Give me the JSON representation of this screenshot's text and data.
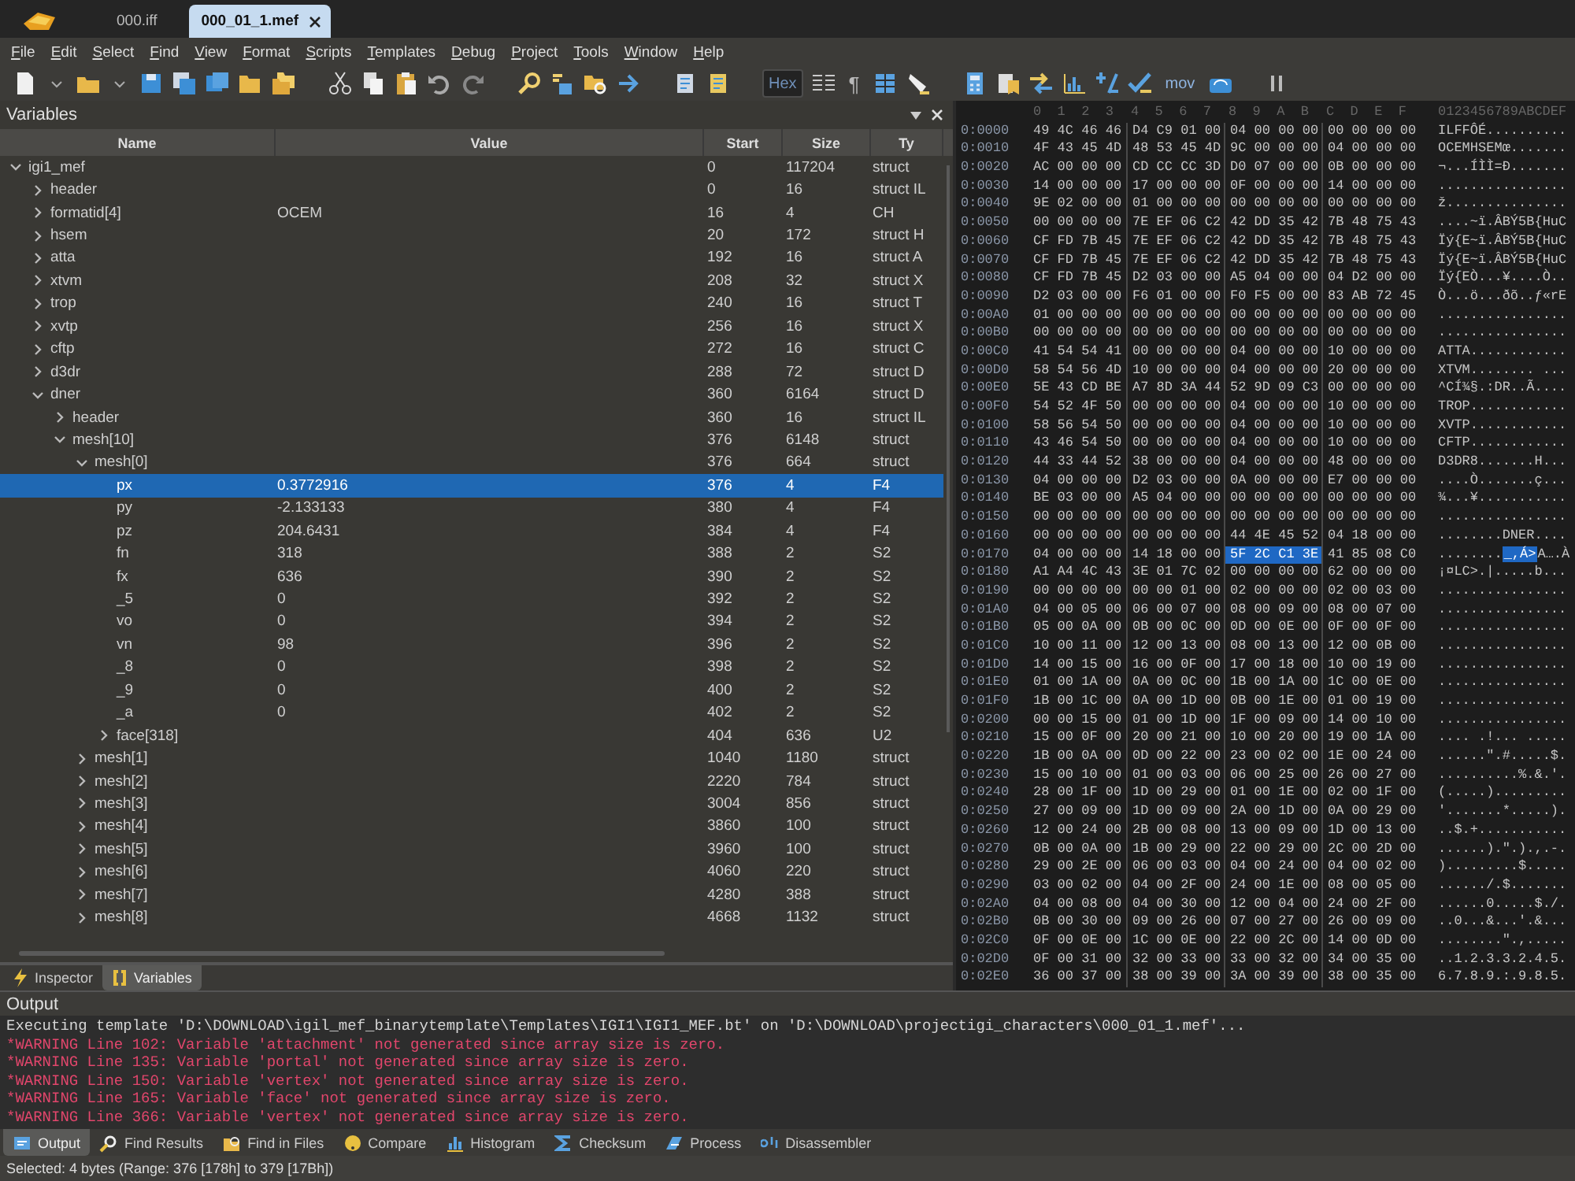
{
  "tabs": [
    {
      "label": "000.iff",
      "selected": false
    },
    {
      "label": "000_01_1.mef",
      "selected": true
    }
  ],
  "menu": [
    "File",
    "Edit",
    "Select",
    "Find",
    "View",
    "Format",
    "Scripts",
    "Templates",
    "Debug",
    "Project",
    "Tools",
    "Window",
    "Help"
  ],
  "toolbar": {
    "text_buttons": [
      {
        "label": "Hex",
        "pressed": true
      },
      {
        "label": "¶",
        "pressed": false
      },
      {
        "label": "mov",
        "pressed": false
      }
    ]
  },
  "variables": {
    "title": "Variables",
    "columns": [
      "Name",
      "Value",
      "Start",
      "Size",
      "Ty"
    ],
    "tree": [
      {
        "name": "igi1_mef",
        "start": "0",
        "size": "117204",
        "type": "struct",
        "selected": false,
        "expanded": true,
        "children": [
          {
            "name": "header",
            "start": "0",
            "size": "16",
            "type": "struct IL",
            "selected": false,
            "expanded": false
          },
          {
            "name": "formatid[4]",
            "value": "OCEM",
            "start": "16",
            "size": "4",
            "type": "CH",
            "selected": false,
            "expanded": false
          },
          {
            "name": "hsem",
            "start": "20",
            "size": "172",
            "type": "struct H",
            "selected": false,
            "expanded": false
          },
          {
            "name": "atta",
            "start": "192",
            "size": "16",
            "type": "struct A",
            "selected": false,
            "expanded": false
          },
          {
            "name": "xtvm",
            "start": "208",
            "size": "32",
            "type": "struct X",
            "selected": false,
            "expanded": false
          },
          {
            "name": "trop",
            "start": "240",
            "size": "16",
            "type": "struct T",
            "selected": false,
            "expanded": false
          },
          {
            "name": "xvtp",
            "start": "256",
            "size": "16",
            "type": "struct X",
            "selected": false,
            "expanded": false
          },
          {
            "name": "cftp",
            "start": "272",
            "size": "16",
            "type": "struct C",
            "selected": false,
            "expanded": false
          },
          {
            "name": "d3dr",
            "start": "288",
            "size": "72",
            "type": "struct D",
            "selected": false,
            "expanded": false
          },
          {
            "name": "dner",
            "start": "360",
            "size": "6164",
            "type": "struct D",
            "selected": false,
            "expanded": true,
            "children": [
              {
                "name": "header",
                "start": "360",
                "size": "16",
                "type": "struct IL",
                "selected": false,
                "expanded": false
              },
              {
                "name": "mesh[10]",
                "start": "376",
                "size": "6148",
                "type": "struct",
                "selected": false,
                "expanded": true,
                "children": [
                  {
                    "name": "mesh[0]",
                    "start": "376",
                    "size": "664",
                    "type": "struct",
                    "selected": false,
                    "expanded": true,
                    "children": [
                      {
                        "name": "px",
                        "value": "0.3772916",
                        "start": "376",
                        "size": "4",
                        "type": "F4",
                        "selected": true
                      },
                      {
                        "name": "py",
                        "value": "-2.133133",
                        "start": "380",
                        "size": "4",
                        "type": "F4",
                        "selected": false
                      },
                      {
                        "name": "pz",
                        "value": "204.6431",
                        "start": "384",
                        "size": "4",
                        "type": "F4",
                        "selected": false
                      },
                      {
                        "name": "fn",
                        "value": "318",
                        "start": "388",
                        "size": "2",
                        "type": "S2",
                        "selected": false
                      },
                      {
                        "name": "fx",
                        "value": "636",
                        "start": "390",
                        "size": "2",
                        "type": "S2",
                        "selected": false
                      },
                      {
                        "name": "_5",
                        "value": "0",
                        "start": "392",
                        "size": "2",
                        "type": "S2",
                        "selected": false
                      },
                      {
                        "name": "vo",
                        "value": "0",
                        "start": "394",
                        "size": "2",
                        "type": "S2",
                        "selected": false
                      },
                      {
                        "name": "vn",
                        "value": "98",
                        "start": "396",
                        "size": "2",
                        "type": "S2",
                        "selected": false
                      },
                      {
                        "name": "_8",
                        "value": "0",
                        "start": "398",
                        "size": "2",
                        "type": "S2",
                        "selected": false
                      },
                      {
                        "name": "_9",
                        "value": "0",
                        "start": "400",
                        "size": "2",
                        "type": "S2",
                        "selected": false
                      },
                      {
                        "name": "_a",
                        "value": "0",
                        "start": "402",
                        "size": "2",
                        "type": "S2",
                        "selected": false
                      },
                      {
                        "name": "face[318]",
                        "start": "404",
                        "size": "636",
                        "type": "U2",
                        "selected": false,
                        "expanded": false
                      }
                    ]
                  },
                  {
                    "name": "mesh[1]",
                    "start": "1040",
                    "size": "1180",
                    "type": "struct",
                    "selected": false,
                    "expanded": false
                  },
                  {
                    "name": "mesh[2]",
                    "start": "2220",
                    "size": "784",
                    "type": "struct",
                    "selected": false,
                    "expanded": false
                  },
                  {
                    "name": "mesh[3]",
                    "start": "3004",
                    "size": "856",
                    "type": "struct",
                    "selected": false,
                    "expanded": false
                  },
                  {
                    "name": "mesh[4]",
                    "start": "3860",
                    "size": "100",
                    "type": "struct",
                    "selected": false,
                    "expanded": false
                  },
                  {
                    "name": "mesh[5]",
                    "start": "3960",
                    "size": "100",
                    "type": "struct",
                    "selected": false,
                    "expanded": false
                  },
                  {
                    "name": "mesh[6]",
                    "start": "4060",
                    "size": "220",
                    "type": "struct",
                    "selected": false,
                    "expanded": false
                  },
                  {
                    "name": "mesh[7]",
                    "start": "4280",
                    "size": "388",
                    "type": "struct",
                    "selected": false,
                    "expanded": false
                  },
                  {
                    "name": "mesh[8]",
                    "start": "4668",
                    "size": "1132",
                    "type": "struct",
                    "selected": false,
                    "expanded": false
                  }
                ]
              }
            ]
          }
        ]
      }
    ],
    "panel_tabs": [
      {
        "label": "Inspector",
        "selected": false
      },
      {
        "label": "Variables",
        "selected": true
      }
    ]
  },
  "hex_view": {
    "columns": [
      "0",
      "1",
      "2",
      "3",
      "4",
      "5",
      "6",
      "7",
      "8",
      "9",
      "A",
      "B",
      "C",
      "D",
      "E",
      "F"
    ],
    "ascii_header": "0123456789ABCDEF",
    "rows": [
      {
        "offset": "0:0000",
        "groups": [
          {
            "hex": "49 4C 46 46",
            "ascii": "ILFF",
            "selected": false
          },
          {
            "hex": "D4 C9 01 00",
            "ascii": "ÔÉ..",
            "selected": false
          },
          {
            "hex": "04 00 00 00",
            "ascii": "....",
            "selected": false
          },
          {
            "hex": "00 00 00 00",
            "ascii": "....",
            "selected": false
          }
        ]
      },
      {
        "offset": "0:0010",
        "groups": [
          {
            "hex": "4F 43 45 4D",
            "ascii": "OCEM",
            "selected": false
          },
          {
            "hex": "48 53 45 4D",
            "ascii": "HSEM",
            "selected": false
          },
          {
            "hex": "9C 00 00 00",
            "ascii": "œ...",
            "selected": false
          },
          {
            "hex": "04 00 00 00",
            "ascii": "....",
            "selected": false
          }
        ]
      },
      {
        "offset": "0:0020",
        "groups": [
          {
            "hex": "AC 00 00 00",
            "ascii": "¬...",
            "selected": false
          },
          {
            "hex": "CD CC CC 3D",
            "ascii": "ÍÌÌ=",
            "selected": false
          },
          {
            "hex": "D0 07 00 00",
            "ascii": "Ð...",
            "selected": false
          },
          {
            "hex": "0B 00 00 00",
            "ascii": "....",
            "selected": false
          }
        ]
      },
      {
        "offset": "0:0030",
        "groups": [
          {
            "hex": "14 00 00 00",
            "ascii": "....",
            "selected": false
          },
          {
            "hex": "17 00 00 00",
            "ascii": "....",
            "selected": false
          },
          {
            "hex": "0F 00 00 00",
            "ascii": "....",
            "selected": false
          },
          {
            "hex": "14 00 00 00",
            "ascii": "....",
            "selected": false
          }
        ]
      },
      {
        "offset": "0:0040",
        "groups": [
          {
            "hex": "9E 02 00 00",
            "ascii": "ž...",
            "selected": false
          },
          {
            "hex": "01 00 00 00",
            "ascii": "....",
            "selected": false
          },
          {
            "hex": "00 00 00 00",
            "ascii": "....",
            "selected": false
          },
          {
            "hex": "00 00 00 00",
            "ascii": "....",
            "selected": false
          }
        ]
      },
      {
        "offset": "0:0050",
        "groups": [
          {
            "hex": "00 00 00 00",
            "ascii": "....",
            "selected": false
          },
          {
            "hex": "7E EF 06 C2",
            "ascii": "~ï.Â",
            "selected": false
          },
          {
            "hex": "42 DD 35 42",
            "ascii": "BÝ5B",
            "selected": false
          },
          {
            "hex": "7B 48 75 43",
            "ascii": "{HuC",
            "selected": false
          }
        ]
      },
      {
        "offset": "0:0060",
        "groups": [
          {
            "hex": "CF FD 7B 45",
            "ascii": "Ïý{E",
            "selected": false
          },
          {
            "hex": "7E EF 06 C2",
            "ascii": "~ï.Â",
            "selected": false
          },
          {
            "hex": "42 DD 35 42",
            "ascii": "BÝ5B",
            "selected": false
          },
          {
            "hex": "7B 48 75 43",
            "ascii": "{HuC",
            "selected": false
          }
        ]
      },
      {
        "offset": "0:0070",
        "groups": [
          {
            "hex": "CF FD 7B 45",
            "ascii": "Ïý{E",
            "selected": false
          },
          {
            "hex": "7E EF 06 C2",
            "ascii": "~ï.Â",
            "selected": false
          },
          {
            "hex": "42 DD 35 42",
            "ascii": "BÝ5B",
            "selected": false
          },
          {
            "hex": "7B 48 75 43",
            "ascii": "{HuC",
            "selected": false
          }
        ]
      },
      {
        "offset": "0:0080",
        "groups": [
          {
            "hex": "CF FD 7B 45",
            "ascii": "Ïý{E",
            "selected": false
          },
          {
            "hex": "D2 03 00 00",
            "ascii": "Ò...",
            "selected": false
          },
          {
            "hex": "A5 04 00 00",
            "ascii": "¥...",
            "selected": false
          },
          {
            "hex": "04 D2 00 00",
            "ascii": ".Ò..",
            "selected": false
          }
        ]
      },
      {
        "offset": "0:0090",
        "groups": [
          {
            "hex": "D2 03 00 00",
            "ascii": "Ò...",
            "selected": false
          },
          {
            "hex": "F6 01 00 00",
            "ascii": "ö...",
            "selected": false
          },
          {
            "hex": "F0 F5 00 00",
            "ascii": "ðõ..",
            "selected": false
          },
          {
            "hex": "83 AB 72 45",
            "ascii": "ƒ«rE",
            "selected": false
          }
        ]
      },
      {
        "offset": "0:00A0",
        "groups": [
          {
            "hex": "01 00 00 00",
            "ascii": "....",
            "selected": false
          },
          {
            "hex": "00 00 00 00",
            "ascii": "....",
            "selected": false
          },
          {
            "hex": "00 00 00 00",
            "ascii": "....",
            "selected": false
          },
          {
            "hex": "00 00 00 00",
            "ascii": "....",
            "selected": false
          }
        ]
      },
      {
        "offset": "0:00B0",
        "groups": [
          {
            "hex": "00 00 00 00",
            "ascii": "....",
            "selected": false
          },
          {
            "hex": "00 00 00 00",
            "ascii": "....",
            "selected": false
          },
          {
            "hex": "00 00 00 00",
            "ascii": "....",
            "selected": false
          },
          {
            "hex": "00 00 00 00",
            "ascii": "....",
            "selected": false
          }
        ]
      },
      {
        "offset": "0:00C0",
        "groups": [
          {
            "hex": "41 54 54 41",
            "ascii": "ATTA",
            "selected": false
          },
          {
            "hex": "00 00 00 00",
            "ascii": "....",
            "selected": false
          },
          {
            "hex": "04 00 00 00",
            "ascii": "....",
            "selected": false
          },
          {
            "hex": "10 00 00 00",
            "ascii": "....",
            "selected": false
          }
        ]
      },
      {
        "offset": "0:00D0",
        "groups": [
          {
            "hex": "58 54 56 4D",
            "ascii": "XTVM",
            "selected": false
          },
          {
            "hex": "10 00 00 00",
            "ascii": "....",
            "selected": false
          },
          {
            "hex": "04 00 00 00",
            "ascii": "....",
            "selected": false
          },
          {
            "hex": "20 00 00 00",
            "ascii": " ...",
            "selected": false
          }
        ]
      },
      {
        "offset": "0:00E0",
        "groups": [
          {
            "hex": "5E 43 CD BE",
            "ascii": "^CÍ¾",
            "selected": false
          },
          {
            "hex": "A7 8D 3A 44",
            "ascii": "§.:D",
            "selected": false
          },
          {
            "hex": "52 9D 09 C3",
            "ascii": "R..Ã",
            "selected": false
          },
          {
            "hex": "00 00 00 00",
            "ascii": "....",
            "selected": false
          }
        ]
      },
      {
        "offset": "0:00F0",
        "groups": [
          {
            "hex": "54 52 4F 50",
            "ascii": "TROP",
            "selected": false
          },
          {
            "hex": "00 00 00 00",
            "ascii": "....",
            "selected": false
          },
          {
            "hex": "04 00 00 00",
            "ascii": "....",
            "selected": false
          },
          {
            "hex": "10 00 00 00",
            "ascii": "....",
            "selected": false
          }
        ]
      },
      {
        "offset": "0:0100",
        "groups": [
          {
            "hex": "58 56 54 50",
            "ascii": "XVTP",
            "selected": false
          },
          {
            "hex": "00 00 00 00",
            "ascii": "....",
            "selected": false
          },
          {
            "hex": "04 00 00 00",
            "ascii": "....",
            "selected": false
          },
          {
            "hex": "10 00 00 00",
            "ascii": "....",
            "selected": false
          }
        ]
      },
      {
        "offset": "0:0110",
        "groups": [
          {
            "hex": "43 46 54 50",
            "ascii": "CFTP",
            "selected": false
          },
          {
            "hex": "00 00 00 00",
            "ascii": "....",
            "selected": false
          },
          {
            "hex": "04 00 00 00",
            "ascii": "....",
            "selected": false
          },
          {
            "hex": "10 00 00 00",
            "ascii": "....",
            "selected": false
          }
        ]
      },
      {
        "offset": "0:0120",
        "groups": [
          {
            "hex": "44 33 44 52",
            "ascii": "D3DR",
            "selected": false
          },
          {
            "hex": "38 00 00 00",
            "ascii": "8...",
            "selected": false
          },
          {
            "hex": "04 00 00 00",
            "ascii": "....",
            "selected": false
          },
          {
            "hex": "48 00 00 00",
            "ascii": "H...",
            "selected": false
          }
        ]
      },
      {
        "offset": "0:0130",
        "groups": [
          {
            "hex": "04 00 00 00",
            "ascii": "....",
            "selected": false
          },
          {
            "hex": "D2 03 00 00",
            "ascii": "Ò...",
            "selected": false
          },
          {
            "hex": "0A 00 00 00",
            "ascii": "....",
            "selected": false
          },
          {
            "hex": "E7 00 00 00",
            "ascii": "ç...",
            "selected": false
          }
        ]
      },
      {
        "offset": "0:0140",
        "groups": [
          {
            "hex": "BE 03 00 00",
            "ascii": "¾...",
            "selected": false
          },
          {
            "hex": "A5 04 00 00",
            "ascii": "¥...",
            "selected": false
          },
          {
            "hex": "00 00 00 00",
            "ascii": "....",
            "selected": false
          },
          {
            "hex": "00 00 00 00",
            "ascii": "....",
            "selected": false
          }
        ]
      },
      {
        "offset": "0:0150",
        "groups": [
          {
            "hex": "00 00 00 00",
            "ascii": "....",
            "selected": false
          },
          {
            "hex": "00 00 00 00",
            "ascii": "....",
            "selected": false
          },
          {
            "hex": "00 00 00 00",
            "ascii": "....",
            "selected": false
          },
          {
            "hex": "00 00 00 00",
            "ascii": "....",
            "selected": false
          }
        ]
      },
      {
        "offset": "0:0160",
        "groups": [
          {
            "hex": "00 00 00 00",
            "ascii": "....",
            "selected": false
          },
          {
            "hex": "00 00 00 00",
            "ascii": "....",
            "selected": false
          },
          {
            "hex": "44 4E 45 52",
            "ascii": "DNER",
            "selected": false
          },
          {
            "hex": "04 18 00 00",
            "ascii": "....",
            "selected": false
          }
        ]
      },
      {
        "offset": "0:0170",
        "groups": [
          {
            "hex": "04 00 00 00",
            "ascii": "....",
            "selected": false
          },
          {
            "hex": "14 18 00 00",
            "ascii": "....",
            "selected": false
          },
          {
            "hex": "5F 2C C1 3E",
            "ascii": "_,Á>",
            "selected": true
          },
          {
            "hex": "41 85 08 C0",
            "ascii": "A….À",
            "selected": false
          }
        ]
      },
      {
        "offset": "0:0180",
        "groups": [
          {
            "hex": "A1 A4 4C 43",
            "ascii": "¡¤LC",
            "selected": false
          },
          {
            "hex": "3E 01 7C 02",
            "ascii": ">.|.",
            "selected": false
          },
          {
            "hex": "00 00 00 00",
            "ascii": "....",
            "selected": false
          },
          {
            "hex": "62 00 00 00",
            "ascii": "b...",
            "selected": false
          }
        ]
      },
      {
        "offset": "0:0190",
        "groups": [
          {
            "hex": "00 00 00 00",
            "ascii": "....",
            "selected": false
          },
          {
            "hex": "00 00 01 00",
            "ascii": "....",
            "selected": false
          },
          {
            "hex": "02 00 00 00",
            "ascii": "....",
            "selected": false
          },
          {
            "hex": "02 00 03 00",
            "ascii": "....",
            "selected": false
          }
        ]
      },
      {
        "offset": "0:01A0",
        "groups": [
          {
            "hex": "04 00 05 00",
            "ascii": "....",
            "selected": false
          },
          {
            "hex": "06 00 07 00",
            "ascii": "....",
            "selected": false
          },
          {
            "hex": "08 00 09 00",
            "ascii": "....",
            "selected": false
          },
          {
            "hex": "08 00 07 00",
            "ascii": "....",
            "selected": false
          }
        ]
      },
      {
        "offset": "0:01B0",
        "groups": [
          {
            "hex": "05 00 0A 00",
            "ascii": "....",
            "selected": false
          },
          {
            "hex": "0B 00 0C 00",
            "ascii": "....",
            "selected": false
          },
          {
            "hex": "0D 00 0E 00",
            "ascii": "....",
            "selected": false
          },
          {
            "hex": "0F 00 0F 00",
            "ascii": "....",
            "selected": false
          }
        ]
      },
      {
        "offset": "0:01C0",
        "groups": [
          {
            "hex": "10 00 11 00",
            "ascii": "....",
            "selected": false
          },
          {
            "hex": "12 00 13 00",
            "ascii": "....",
            "selected": false
          },
          {
            "hex": "08 00 13 00",
            "ascii": "....",
            "selected": false
          },
          {
            "hex": "12 00 0B 00",
            "ascii": "....",
            "selected": false
          }
        ]
      },
      {
        "offset": "0:01D0",
        "groups": [
          {
            "hex": "14 00 15 00",
            "ascii": "....",
            "selected": false
          },
          {
            "hex": "16 00 0F 00",
            "ascii": "....",
            "selected": false
          },
          {
            "hex": "17 00 18 00",
            "ascii": "....",
            "selected": false
          },
          {
            "hex": "10 00 19 00",
            "ascii": "....",
            "selected": false
          }
        ]
      },
      {
        "offset": "0:01E0",
        "groups": [
          {
            "hex": "01 00 1A 00",
            "ascii": "....",
            "selected": false
          },
          {
            "hex": "0A 00 0C 00",
            "ascii": "....",
            "selected": false
          },
          {
            "hex": "1B 00 1A 00",
            "ascii": "....",
            "selected": false
          },
          {
            "hex": "1C 00 0E 00",
            "ascii": "....",
            "selected": false
          }
        ]
      },
      {
        "offset": "0:01F0",
        "groups": [
          {
            "hex": "1B 00 1C 00",
            "ascii": "....",
            "selected": false
          },
          {
            "hex": "0A 00 1D 00",
            "ascii": "....",
            "selected": false
          },
          {
            "hex": "0B 00 1E 00",
            "ascii": "....",
            "selected": false
          },
          {
            "hex": "01 00 19 00",
            "ascii": "....",
            "selected": false
          }
        ]
      },
      {
        "offset": "0:0200",
        "groups": [
          {
            "hex": "00 00 15 00",
            "ascii": "....",
            "selected": false
          },
          {
            "hex": "01 00 1D 00",
            "ascii": "....",
            "selected": false
          },
          {
            "hex": "1F 00 09 00",
            "ascii": "....",
            "selected": false
          },
          {
            "hex": "14 00 10 00",
            "ascii": "....",
            "selected": false
          }
        ]
      },
      {
        "offset": "0:0210",
        "groups": [
          {
            "hex": "15 00 0F 00",
            "ascii": "....",
            "selected": false
          },
          {
            "hex": "20 00 21 00",
            "ascii": " .!.",
            "selected": false
          },
          {
            "hex": "10 00 20 00",
            "ascii": ".. .",
            "selected": false
          },
          {
            "hex": "19 00 1A 00",
            "ascii": "....",
            "selected": false
          }
        ]
      },
      {
        "offset": "0:0220",
        "groups": [
          {
            "hex": "1B 00 0A 00",
            "ascii": "....",
            "selected": false
          },
          {
            "hex": "0D 00 22 00",
            "ascii": "..\".",
            "selected": false
          },
          {
            "hex": "23 00 02 00",
            "ascii": "#...",
            "selected": false
          },
          {
            "hex": "1E 00 24 00",
            "ascii": "..$.",
            "selected": false
          }
        ]
      },
      {
        "offset": "0:0230",
        "groups": [
          {
            "hex": "15 00 10 00",
            "ascii": "....",
            "selected": false
          },
          {
            "hex": "01 00 03 00",
            "ascii": "....",
            "selected": false
          },
          {
            "hex": "06 00 25 00",
            "ascii": "..%.",
            "selected": false
          },
          {
            "hex": "26 00 27 00",
            "ascii": "&.'.",
            "selected": false
          }
        ]
      },
      {
        "offset": "0:0240",
        "groups": [
          {
            "hex": "28 00 1F 00",
            "ascii": "(...",
            "selected": false
          },
          {
            "hex": "1D 00 29 00",
            "ascii": "..).",
            "selected": false
          },
          {
            "hex": "01 00 1E 00",
            "ascii": "....",
            "selected": false
          },
          {
            "hex": "02 00 1F 00",
            "ascii": "....",
            "selected": false
          }
        ]
      },
      {
        "offset": "0:0250",
        "groups": [
          {
            "hex": "27 00 09 00",
            "ascii": "'...",
            "selected": false
          },
          {
            "hex": "1D 00 09 00",
            "ascii": "....",
            "selected": false
          },
          {
            "hex": "2A 00 1D 00",
            "ascii": "*...",
            "selected": false
          },
          {
            "hex": "0A 00 29 00",
            "ascii": "..).",
            "selected": false
          }
        ]
      },
      {
        "offset": "0:0260",
        "groups": [
          {
            "hex": "12 00 24 00",
            "ascii": "..$.",
            "selected": false
          },
          {
            "hex": "2B 00 08 00",
            "ascii": "+...",
            "selected": false
          },
          {
            "hex": "13 00 09 00",
            "ascii": "....",
            "selected": false
          },
          {
            "hex": "1D 00 13 00",
            "ascii": "....",
            "selected": false
          }
        ]
      },
      {
        "offset": "0:0270",
        "groups": [
          {
            "hex": "0B 00 0A 00",
            "ascii": "....",
            "selected": false
          },
          {
            "hex": "1B 00 29 00",
            "ascii": "..).",
            "selected": false
          },
          {
            "hex": "22 00 29 00",
            "ascii": "\".).",
            "selected": false
          },
          {
            "hex": "2C 00 2D 00",
            "ascii": ",.-.",
            "selected": false
          }
        ]
      },
      {
        "offset": "0:0280",
        "groups": [
          {
            "hex": "29 00 2E 00",
            "ascii": ")...",
            "selected": false
          },
          {
            "hex": "06 00 03 00",
            "ascii": "....",
            "selected": false
          },
          {
            "hex": "04 00 24 00",
            "ascii": "..$.",
            "selected": false
          },
          {
            "hex": "04 00 02 00",
            "ascii": "....",
            "selected": false
          }
        ]
      },
      {
        "offset": "0:0290",
        "groups": [
          {
            "hex": "03 00 02 00",
            "ascii": "....",
            "selected": false
          },
          {
            "hex": "04 00 2F 00",
            "ascii": "../.",
            "selected": false
          },
          {
            "hex": "24 00 1E 00",
            "ascii": "$...",
            "selected": false
          },
          {
            "hex": "08 00 05 00",
            "ascii": "....",
            "selected": false
          }
        ]
      },
      {
        "offset": "0:02A0",
        "groups": [
          {
            "hex": "04 00 08 00",
            "ascii": "....",
            "selected": false
          },
          {
            "hex": "04 00 30 00",
            "ascii": "..0.",
            "selected": false
          },
          {
            "hex": "12 00 04 00",
            "ascii": "....",
            "selected": false
          },
          {
            "hex": "24 00 2F 00",
            "ascii": "$./.",
            "selected": false
          }
        ]
      },
      {
        "offset": "0:02B0",
        "groups": [
          {
            "hex": "0B 00 30 00",
            "ascii": "..0.",
            "selected": false
          },
          {
            "hex": "09 00 26 00",
            "ascii": "..&.",
            "selected": false
          },
          {
            "hex": "07 00 27 00",
            "ascii": "..'.",
            "selected": false
          },
          {
            "hex": "26 00 09 00",
            "ascii": "&...",
            "selected": false
          }
        ]
      },
      {
        "offset": "0:02C0",
        "groups": [
          {
            "hex": "0F 00 0E 00",
            "ascii": "....",
            "selected": false
          },
          {
            "hex": "1C 00 0E 00",
            "ascii": "....",
            "selected": false
          },
          {
            "hex": "22 00 2C 00",
            "ascii": "\".,.",
            "selected": false
          },
          {
            "hex": "14 00 0D 00",
            "ascii": "....",
            "selected": false
          }
        ]
      },
      {
        "offset": "0:02D0",
        "groups": [
          {
            "hex": "0F 00 31 00",
            "ascii": "..1.",
            "selected": false
          },
          {
            "hex": "32 00 33 00",
            "ascii": "2.3.",
            "selected": false
          },
          {
            "hex": "33 00 32 00",
            "ascii": "3.2.",
            "selected": false
          },
          {
            "hex": "34 00 35 00",
            "ascii": "4.5.",
            "selected": false
          }
        ]
      },
      {
        "offset": "0:02E0",
        "groups": [
          {
            "hex": "36 00 37 00",
            "ascii": "6.7.",
            "selected": false
          },
          {
            "hex": "38 00 39 00",
            "ascii": "8.9.",
            "selected": false
          },
          {
            "hex": "3A 00 39 00",
            "ascii": ":.9.",
            "selected": false
          },
          {
            "hex": "38 00 35 00",
            "ascii": "8.5.",
            "selected": false
          }
        ]
      }
    ]
  },
  "output": {
    "title": "Output",
    "lines": [
      {
        "kind": "info",
        "text": "Executing template 'D:\\DOWNLOAD\\igil_mef_binarytemplate\\Templates\\IGI1\\IGI1_MEF.bt' on 'D:\\DOWNLOAD\\projectigi_characters\\000_01_1.mef'..."
      },
      {
        "kind": "warning",
        "text": "*WARNING Line 102: Variable 'attachment' not generated since array size is zero."
      },
      {
        "kind": "warning",
        "text": "*WARNING Line 135: Variable 'portal' not generated since array size is zero."
      },
      {
        "kind": "warning",
        "text": "*WARNING Line 150: Variable 'vertex' not generated since array size is zero."
      },
      {
        "kind": "warning",
        "text": "*WARNING Line 165: Variable 'face' not generated since array size is zero."
      },
      {
        "kind": "warning",
        "text": "*WARNING Line 366: Variable 'vertex' not generated since array size is zero."
      }
    ],
    "tabs": [
      {
        "label": "Output",
        "selected": true
      },
      {
        "label": "Find Results",
        "selected": false
      },
      {
        "label": "Find in Files",
        "selected": false
      },
      {
        "label": "Compare",
        "selected": false
      },
      {
        "label": "Histogram",
        "selected": false
      },
      {
        "label": "Checksum",
        "selected": false
      },
      {
        "label": "Process",
        "selected": false
      },
      {
        "label": "Disassembler",
        "selected": false
      }
    ]
  },
  "status_bar": {
    "text": "Selected: 4 bytes (Range: 376 [178h] to 379 [17Bh])"
  }
}
